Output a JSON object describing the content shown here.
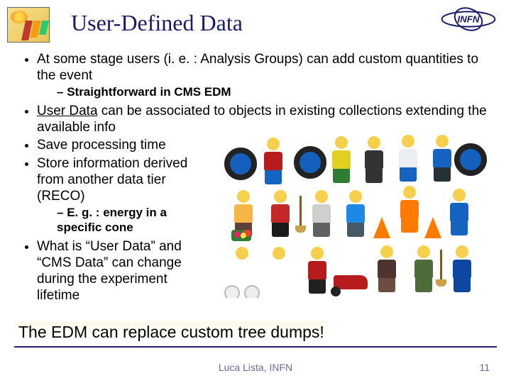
{
  "title": "User-Defined Data",
  "logos": {
    "left": "cms-logo",
    "right_text": "INFN"
  },
  "bullets": {
    "b1": "At some stage users (i. e. : Analysis Groups) can add custom quantities to the event",
    "b1_sub1": "Straightforward in CMS EDM",
    "b2_pre": "User Data",
    "b2_post": " can be associated to objects in existing collections extending the available info",
    "b3": "Save processing time",
    "b4": "Store information derived from another data tier (RECO)",
    "b4_sub1": "E. g. : energy in a specific cone",
    "b5": "What is “User Data” and “CMS Data” can change during the experiment lifetime"
  },
  "callout": "The EDM can replace custom tree dumps!",
  "footer": {
    "author": "Luca Lista, INFN",
    "page": "11"
  },
  "image_alt": "lego-minifigures-community-workers"
}
